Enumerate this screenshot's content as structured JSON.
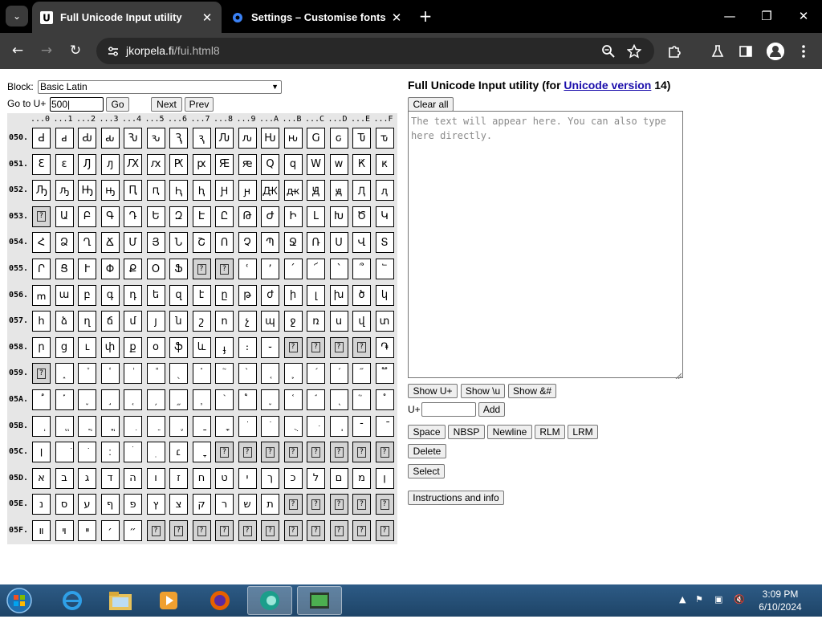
{
  "browser": {
    "tabs": [
      {
        "title": "Full Unicode Input utility",
        "active": true,
        "favicon": "unicode-favicon"
      },
      {
        "title": "Settings – Customise fonts",
        "active": false,
        "favicon": "settings-gear-favicon"
      }
    ],
    "url_host": "jkorpela.fi",
    "url_path": "/fui.html8"
  },
  "left": {
    "block_label": "Block:",
    "block_value": "Basic Latin",
    "goto_label": "Go to U+",
    "goto_value": "500",
    "go_button": "Go",
    "next_button": "Next",
    "prev_button": "Prev",
    "col_headers": [
      "...0",
      "...1",
      "...2",
      "...3",
      "...4",
      "...5",
      "...6",
      "...7",
      "...8",
      "...9",
      "...A",
      "...B",
      "...C",
      "...D",
      "...E",
      "...F"
    ],
    "missing_glyph": "?",
    "rows": [
      {
        "label": "050.",
        "cells": [
          "Ԁ",
          "ԁ",
          "Ԃ",
          "ԃ",
          "Ԅ",
          "ԅ",
          "Ԇ",
          "ԇ",
          "Ԉ",
          "ԉ",
          "Ԋ",
          "ԋ",
          "Ԍ",
          "ԍ",
          "Ԏ",
          "ԏ"
        ]
      },
      {
        "label": "051.",
        "cells": [
          "Ԑ",
          "ԑ",
          "Ԓ",
          "ԓ",
          "Ԕ",
          "ԕ",
          "Ԗ",
          "ԗ",
          "Ԙ",
          "ԙ",
          "Ԛ",
          "ԛ",
          "Ԝ",
          "ԝ",
          "Ԟ",
          "ԟ"
        ]
      },
      {
        "label": "052.",
        "cells": [
          "Ԡ",
          "ԡ",
          "Ԣ",
          "ԣ",
          "Ԥ",
          "ԥ",
          "Ԧ",
          "ԧ",
          "Ԩ",
          "ԩ",
          "Ԫ",
          "ԫ",
          "Ԭ",
          "ԭ",
          "Ԯ",
          "ԯ"
        ]
      },
      {
        "label": "053.",
        "cells": [
          null,
          "Ա",
          "Բ",
          "Գ",
          "Դ",
          "Ե",
          "Զ",
          "Է",
          "Ը",
          "Թ",
          "Ժ",
          "Ի",
          "Լ",
          "Խ",
          "Ծ",
          "Կ"
        ]
      },
      {
        "label": "054.",
        "cells": [
          "Հ",
          "Ձ",
          "Ղ",
          "Ճ",
          "Մ",
          "Յ",
          "Ն",
          "Շ",
          "Ո",
          "Չ",
          "Պ",
          "Ջ",
          "Ռ",
          "Ս",
          "Վ",
          "Տ"
        ]
      },
      {
        "label": "055.",
        "cells": [
          "Ր",
          "Ց",
          "Ւ",
          "Փ",
          "Ք",
          "Օ",
          "Ֆ",
          null,
          null,
          "ՙ",
          "՚",
          "՛",
          "՜",
          "՝",
          "՞",
          "՟"
        ]
      },
      {
        "label": "056.",
        "cells": [
          "ՠ",
          "ա",
          "բ",
          "գ",
          "դ",
          "ե",
          "զ",
          "է",
          "ը",
          "թ",
          "ժ",
          "ի",
          "լ",
          "խ",
          "ծ",
          "կ"
        ]
      },
      {
        "label": "057.",
        "cells": [
          "հ",
          "ձ",
          "ղ",
          "ճ",
          "մ",
          "յ",
          "ն",
          "շ",
          "ո",
          "չ",
          "պ",
          "ջ",
          "ռ",
          "ս",
          "վ",
          "տ"
        ]
      },
      {
        "label": "058.",
        "cells": [
          "ր",
          "ց",
          "ւ",
          "փ",
          "ք",
          "օ",
          "ֆ",
          "և",
          "ֈ",
          "։",
          "֊",
          null,
          null,
          null,
          null,
          "֏"
        ]
      },
      {
        "label": "059.",
        "cells": [
          null,
          "֑",
          "֒",
          "֓",
          "֔",
          "֕",
          "֖",
          "֗",
          "֘",
          "֙",
          "֚",
          "֛",
          "֜",
          "֝",
          "֞",
          "֟"
        ]
      },
      {
        "label": "05A.",
        "cells": [
          "֠",
          "֡",
          "֢",
          "֣",
          "֤",
          "֥",
          "֦",
          "֧",
          "֨",
          "֩",
          "֪",
          "֫",
          "֬",
          "֭",
          "֮",
          "֯"
        ]
      },
      {
        "label": "05B.",
        "cells": [
          "ְ",
          "ֱ",
          "ֲ",
          "ֳ",
          "ִ",
          "ֵ",
          "ֶ",
          "ַ",
          "ָ",
          "ֹ",
          "ֺ",
          "ֻ",
          "ּ",
          "ֽ",
          "־",
          "ֿ"
        ]
      },
      {
        "label": "05C.",
        "cells": [
          "׀",
          "ׁ",
          "ׂ",
          "׃",
          "ׄ",
          "ׅ",
          "׆",
          "ׇ",
          null,
          null,
          null,
          null,
          null,
          null,
          null,
          null
        ]
      },
      {
        "label": "05D.",
        "cells": [
          "א",
          "ב",
          "ג",
          "ד",
          "ה",
          "ו",
          "ז",
          "ח",
          "ט",
          "י",
          "ך",
          "כ",
          "ל",
          "ם",
          "מ",
          "ן"
        ]
      },
      {
        "label": "05E.",
        "cells": [
          "נ",
          "ס",
          "ע",
          "ף",
          "פ",
          "ץ",
          "צ",
          "ק",
          "ר",
          "ש",
          "ת",
          null,
          null,
          null,
          null,
          null
        ]
      },
      {
        "label": "05F.",
        "cells": [
          "װ",
          "ױ",
          "ײ",
          "׳",
          "״",
          null,
          null,
          null,
          null,
          null,
          null,
          null,
          null,
          null,
          null,
          null
        ]
      }
    ]
  },
  "right": {
    "heading_pre": "Full Unicode Input utility (for ",
    "heading_link": "Unicode version",
    "heading_post": " 14)",
    "clear_all": "Clear all",
    "textarea_placeholder": "The text will appear here. You can also type here directly.",
    "show_uplus": "Show U+",
    "show_u": "Show \\u",
    "show_amp": "Show &#",
    "uplus_label": "U+",
    "add_button": "Add",
    "space": "Space",
    "nbsp": "NBSP",
    "newline": "Newline",
    "rlm": "RLM",
    "lrm": "LRM",
    "delete": "Delete",
    "select": "Select",
    "instructions": "Instructions and info"
  },
  "taskbar": {
    "time": "3:09 PM",
    "date": "6/10/2024",
    "apps": [
      "internet-explorer-icon",
      "file-explorer-icon",
      "media-player-icon",
      "firefox-icon",
      "edge-app-icon",
      "terminal-app-icon"
    ]
  },
  "colors": {
    "link": "#1a0dab",
    "unassigned_cell": "#d4d4d4",
    "grid_background": "#e6e6e6"
  }
}
